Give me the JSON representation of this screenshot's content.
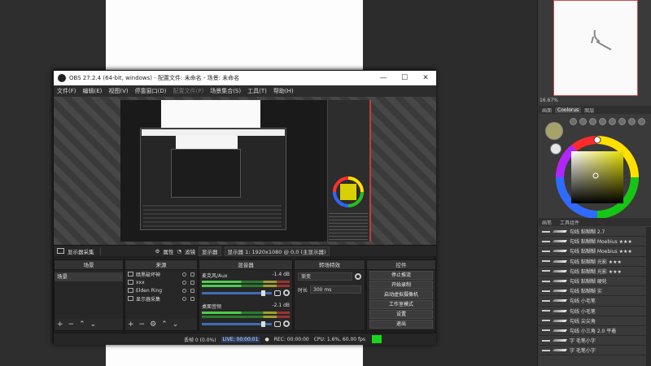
{
  "obs": {
    "title": "OBS 27.2.4 (64-bit, windows) - 配置文件: 未命名 - 场景: 未命名",
    "menu": [
      "文件(F)",
      "编辑(E)",
      "视图(V)",
      "停靠窗口(D)",
      "配置文件(P)",
      "场景集合(S)",
      "工具(T)",
      "帮助(H)"
    ],
    "source_bar": {
      "source_name": "显示器采集",
      "properties": "属性",
      "filters": "滤镜",
      "display_label": "显示器",
      "display_value": "显示器 1: 1920x1080 @ 0,0 (主显示器)"
    },
    "docks": {
      "scenes": {
        "title": "场景",
        "items": [
          "场景"
        ]
      },
      "sources": {
        "title": "来源",
        "items": [
          "暗黑破坏神",
          "xxx",
          "Elden Ring",
          "显示器采集"
        ]
      },
      "mixer": {
        "title": "混音器",
        "channels": [
          {
            "name": "麦克风/Aux",
            "db": "-1.4 dB"
          },
          {
            "name": "桌面音频",
            "db": "-2.1 dB"
          }
        ]
      },
      "transitions": {
        "title": "转场特效",
        "type": "渐变",
        "duration_label": "时长",
        "duration_value": "300 ms"
      },
      "controls": {
        "title": "控件",
        "buttons": [
          "停止推流",
          "开始录制",
          "启动虚拟摄像机",
          "工作室模式",
          "设置",
          "退出"
        ]
      }
    },
    "status": {
      "dropped": "丢帧 0 (0.0%)",
      "live": "LIVE: 00:00:01",
      "rec": "REC: 00:00:00",
      "cpu": "CPU: 1.6%, 60.00 fps"
    }
  },
  "paint_panel": {
    "zoom": "16.67%",
    "tabs": [
      "画面",
      "Coolorus",
      "图层"
    ],
    "tool_tabs": [
      "画笔",
      "工具组件"
    ],
    "brushes": [
      "勾线 黏糊糊 2.7",
      "勾线 黏糊糊 Moebius ★★★",
      "勾线 黏糊糊 Moebius ★★★",
      "勾线 黏糊糊 光影 ★★★",
      "勾线 黏糊糊 光影 ★★★",
      "勾线 黏糊糊 硬轮",
      "勾线 黏糊糊 实",
      "勾线 小毛笔",
      "勾线 小毛笔",
      "勾线 尖尖角",
      "勾线 小三角 2.0 平着",
      "字 毛笔小字",
      "字 毛笔小字"
    ]
  }
}
